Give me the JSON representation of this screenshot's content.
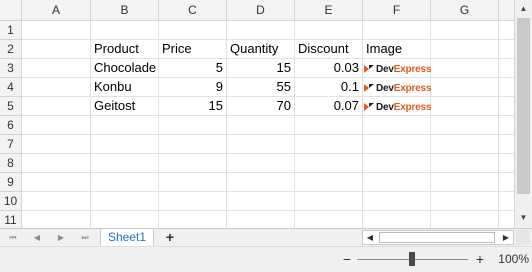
{
  "columns": [
    "A",
    "B",
    "C",
    "D",
    "E",
    "F",
    "G"
  ],
  "rows": [
    "1",
    "2",
    "3",
    "4",
    "5",
    "6",
    "7",
    "8",
    "9",
    "10",
    "11"
  ],
  "header_row": {
    "product": "Product",
    "price": "Price",
    "quantity": "Quantity",
    "discount": "Discount",
    "image": "Image"
  },
  "records": [
    {
      "product": "Chocolade",
      "price": "5",
      "quantity": "15",
      "discount": "0.03"
    },
    {
      "product": "Konbu",
      "price": "9",
      "quantity": "55",
      "discount": "0.1"
    },
    {
      "product": "Geitost",
      "price": "15",
      "quantity": "70",
      "discount": "0.07"
    }
  ],
  "logo": {
    "text_a": "Dev",
    "text_b": "Express",
    "icon": "devexpress-logo-icon"
  },
  "sheet": {
    "tab_label": "Sheet1",
    "add_label": "+"
  },
  "zoom": {
    "level_label": "100%",
    "minus": "−",
    "plus": "+",
    "fraction": 0.5
  },
  "colors": {
    "accent": "#1f6fbf",
    "logo_orange": "#e25b1e",
    "header_bg": "#f3f3f3",
    "grid_line": "#e1e1e1"
  }
}
